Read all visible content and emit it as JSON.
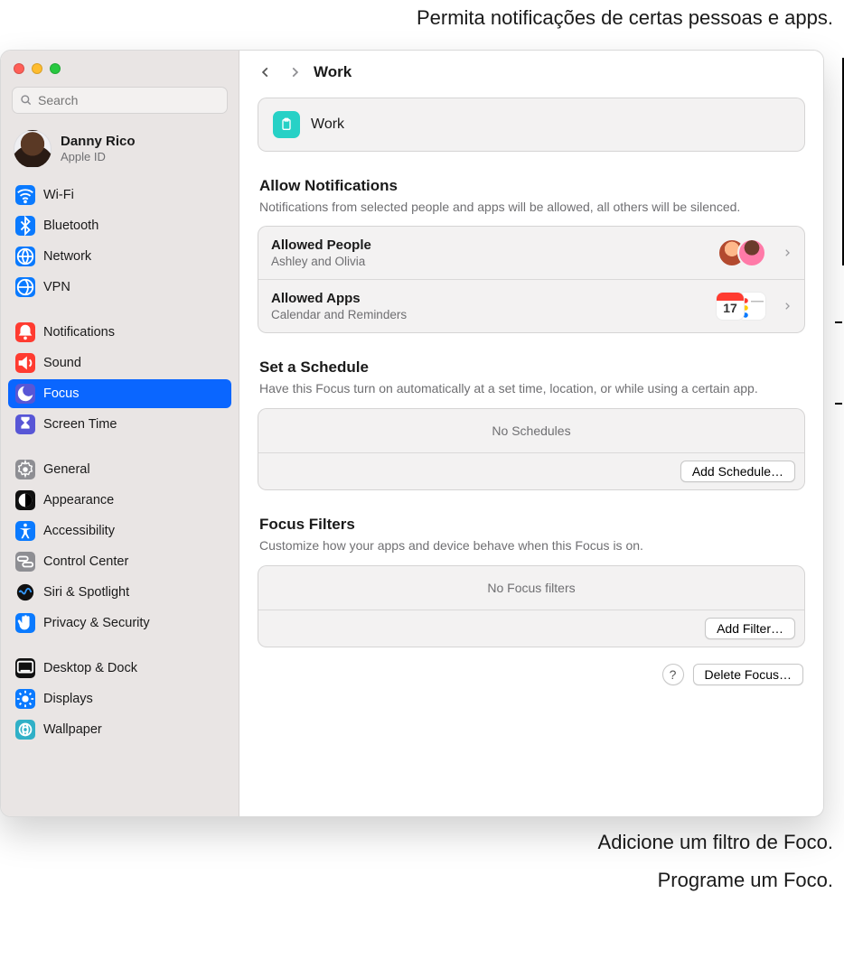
{
  "annotations": {
    "top": "Permita notificações de certas pessoas e apps.",
    "add_filter": "Adicione um filtro de Foco.",
    "add_schedule": "Programe um Foco."
  },
  "search": {
    "placeholder": "Search"
  },
  "user": {
    "name": "Danny Rico",
    "sub": "Apple ID"
  },
  "sidebar": [
    {
      "label": "Wi-Fi",
      "color": "bg-blue",
      "icon": "wifi"
    },
    {
      "label": "Bluetooth",
      "color": "bg-blue",
      "icon": "bluetooth"
    },
    {
      "label": "Network",
      "color": "bg-blue",
      "icon": "globe"
    },
    {
      "label": "VPN",
      "color": "bg-blue",
      "icon": "vpn"
    },
    {
      "gap": true
    },
    {
      "label": "Notifications",
      "color": "bg-red",
      "icon": "bell"
    },
    {
      "label": "Sound",
      "color": "bg-red",
      "icon": "sound"
    },
    {
      "label": "Focus",
      "color": "bg-indigo",
      "icon": "moon",
      "active": true
    },
    {
      "label": "Screen Time",
      "color": "bg-indigo",
      "icon": "hourglass"
    },
    {
      "gap": true
    },
    {
      "label": "General",
      "color": "bg-gray",
      "icon": "gear"
    },
    {
      "label": "Appearance",
      "color": "bg-black",
      "icon": "appearance"
    },
    {
      "label": "Accessibility",
      "color": "bg-blue",
      "icon": "accessibility"
    },
    {
      "label": "Control Center",
      "color": "bg-gray",
      "icon": "switches"
    },
    {
      "label": "Siri & Spotlight",
      "color": "",
      "icon": "siri"
    },
    {
      "label": "Privacy & Security",
      "color": "bg-blue",
      "icon": "hand"
    },
    {
      "gap": true
    },
    {
      "label": "Desktop & Dock",
      "color": "bg-black",
      "icon": "dock"
    },
    {
      "label": "Displays",
      "color": "bg-blue",
      "icon": "display"
    },
    {
      "label": "Wallpaper",
      "color": "bg-teal",
      "icon": "wallpaper"
    }
  ],
  "title": "Work",
  "header_name": "Work",
  "notifications": {
    "heading": "Allow Notifications",
    "desc": "Notifications from selected people and apps will be allowed, all others will be silenced.",
    "people": {
      "title": "Allowed People",
      "sub": "Ashley and Olivia"
    },
    "apps": {
      "title": "Allowed Apps",
      "sub": "Calendar and Reminders"
    }
  },
  "schedule": {
    "heading": "Set a Schedule",
    "desc": "Have this Focus turn on automatically at a set time, location, or while using a certain app.",
    "empty": "No Schedules",
    "button": "Add Schedule…"
  },
  "filters": {
    "heading": "Focus Filters",
    "desc": "Customize how your apps and device behave when this Focus is on.",
    "empty": "No Focus filters",
    "button": "Add Filter…"
  },
  "delete_button": "Delete Focus…",
  "help_glyph": "?"
}
